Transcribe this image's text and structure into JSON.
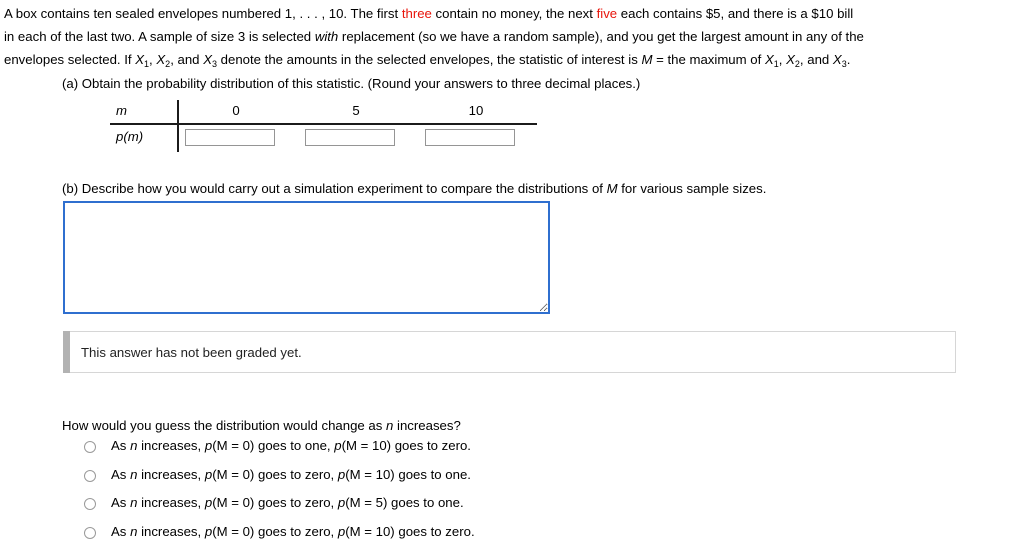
{
  "problem": {
    "line1_a": "A box contains ten sealed envelopes numbered 1, . . . , 10. The first ",
    "line1_red1": "three",
    "line1_b": " contain no money, the next ",
    "line1_red2": "five",
    "line1_c": " each contains $5, and there is a $10 bill",
    "line2_a": "in each of the last two. A sample of size 3 is selected ",
    "line2_italic": "with",
    "line2_b": " replacement (so we have a random sample), and you get the largest amount in any of the",
    "line3_a": "envelopes selected. If ",
    "line3_x1": "X",
    "line3_x1_sub": "1",
    "line3_sep1": ", ",
    "line3_x2": "X",
    "line3_x2_sub": "2",
    "line3_sep2": ", and ",
    "line3_x3": "X",
    "line3_x3_sub": "3",
    "line3_b": " denote the amounts in the selected envelopes, the statistic of interest is ",
    "line3_m": "M",
    "line3_c": " = the maximum of ",
    "line3_x4": "X",
    "line3_x4_sub": "1",
    "line3_sep3": ", ",
    "line3_x5": "X",
    "line3_x5_sub": "2",
    "line3_sep4": ", and ",
    "line3_x6": "X",
    "line3_x6_sub": "3",
    "line3_d": "."
  },
  "part_a": {
    "label": "(a) Obtain the probability distribution of this statistic. (Round your answers to three decimal places.)",
    "table": {
      "row_label_m": "m",
      "row_label_pm": "p(m)",
      "headers": [
        "0",
        "5",
        "10"
      ],
      "values": [
        "",
        "",
        ""
      ],
      "placeholders": [
        "",
        "",
        ""
      ]
    }
  },
  "part_b": {
    "label_a": "(b) Describe how you would carry out a simulation experiment to compare the distributions of ",
    "label_m": "M",
    "label_b": " for various sample sizes.",
    "answer_value": "",
    "answer_placeholder": ""
  },
  "graded_notice": {
    "text": "This answer has not been graded yet."
  },
  "multiple_choice": {
    "question_a": "How would you guess the distribution would change as ",
    "question_n": "n",
    "question_b": " increases?",
    "options": [
      {
        "a": "As ",
        "n": "n",
        "b": " increases, ",
        "p1": "p",
        "p1rest": "(M = 0) goes to one, ",
        "p2": "p",
        "p2rest": "(M = 10) goes to zero."
      },
      {
        "a": "As ",
        "n": "n",
        "b": " increases, ",
        "p1": "p",
        "p1rest": "(M = 0) goes to zero, ",
        "p2": "p",
        "p2rest": "(M = 10) goes to one."
      },
      {
        "a": "As ",
        "n": "n",
        "b": " increases, ",
        "p1": "p",
        "p1rest": "(M = 0) goes to zero, ",
        "p2": "p",
        "p2rest": "(M = 5) goes to one."
      },
      {
        "a": "As ",
        "n": "n",
        "b": " increases, ",
        "p1": "p",
        "p1rest": "(M = 0) goes to zero, ",
        "p2": "p",
        "p2rest": "(M = 10) goes to zero."
      }
    ],
    "selected_index": -1
  },
  "colors": {
    "highlight_red": "#e8160c",
    "textarea_border_blue": "#2f6fcf",
    "accent_gray": "#b2b2b2",
    "rule_black": "#1b1b1b",
    "input_border_gray": "#959595"
  }
}
